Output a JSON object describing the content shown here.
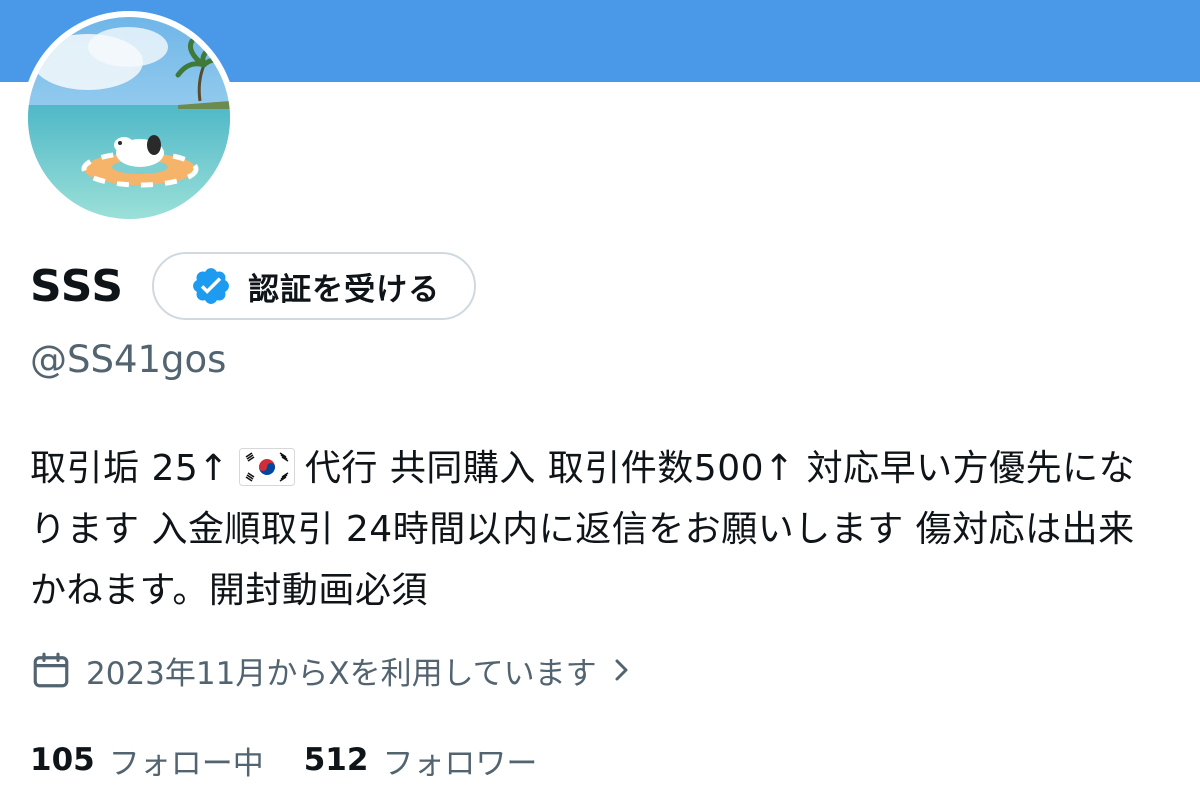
{
  "banner": {
    "color": "#4a99e9"
  },
  "profile": {
    "display_name": "SSS",
    "handle": "@SS41gos",
    "verify_button_label": "認証を受ける",
    "bio_part1": "取引垢 25↑",
    "flag_icon": "korea-flag-icon",
    "bio_part2": "代行 共同購入 取引件数500↑ 対応早い方優先になります 入金順取引 24時間以内に返信をお願いします 傷対応は出来かねます。開封動画必須",
    "joined_text": "2023年11月からXを利用しています",
    "following_count": "105",
    "following_label": "フォロー中",
    "followers_count": "512",
    "followers_label": "フォロワー"
  },
  "icons": {
    "verify_badge": "verified-badge-icon",
    "calendar": "calendar-icon",
    "chevron": "chevron-right-icon"
  },
  "colors": {
    "accent": "#1d9bf0",
    "text": "#0f1419",
    "secondary": "#536471",
    "border": "#cfd9de"
  }
}
